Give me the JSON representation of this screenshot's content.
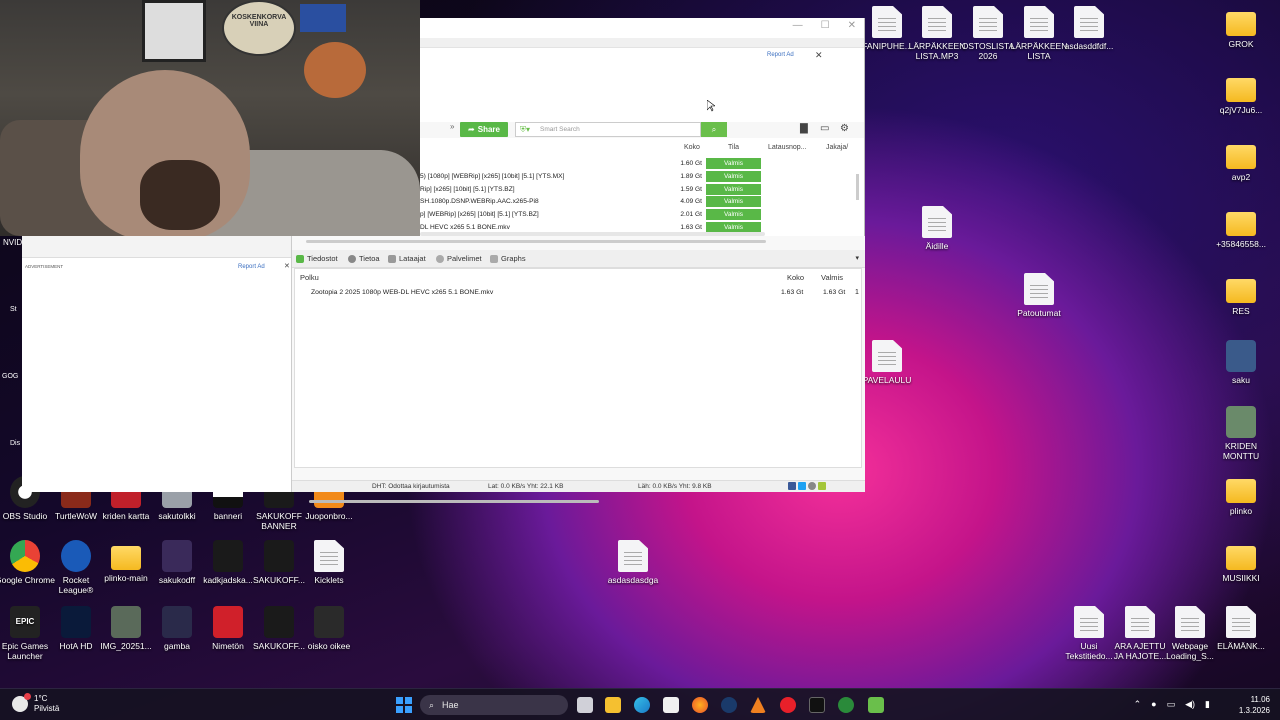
{
  "desktop": {
    "left_icons_row1": [
      "OBS Studio",
      "TurtleWoW",
      "kriden kartta",
      "sakutolkki",
      "banneri",
      "SAKUKOFF BANNER",
      "Juoponbro..."
    ],
    "left_icons_row2": [
      "Google Chrome",
      "Rocket League®",
      "plinko-main",
      "sakukodff",
      "kadkjadska...",
      "SAKUKOFF...",
      "Kicklets"
    ],
    "left_icons_row3": [
      "Epic Games Launcher",
      "HotA HD",
      "IMG_20251...",
      "gamba",
      "Nimetön",
      "SAKUKOFF...",
      "oisko oikee"
    ],
    "left_edge_labels": [
      "NVID",
      "St",
      "GOG",
      "Dis"
    ],
    "center_icon": "asdasdasdga",
    "top_row_icons": [
      "FANIPUHE...",
      "LÄRPÄKKEEN LISTA.MP3",
      "OSTOSLISTA 2026",
      "LÄRPÄKKEEN LISTA",
      "asdasddfdf..."
    ],
    "mid_icons": [
      "Äidille",
      "Patoutumat",
      "PAVELAULU"
    ],
    "right_column": [
      "GROK",
      "q2jV7Ju6...",
      "avp2",
      "+35846558...",
      "RES",
      "saku",
      "KRIDEN MONTTU",
      "plinko",
      "MUSIIKKI"
    ],
    "bottom_right_icons": [
      "Uusi Tekstitiedo...",
      "ARA AJETTU JA HAJOTE...",
      "Webpage Loading_S...",
      "ELÄMÄNK..."
    ]
  },
  "webcam": {
    "sign_text": "KOSKENKORVA VIINA"
  },
  "torrent_window": {
    "report_ad": "Report Ad",
    "ad_close": "✕",
    "toolbar": {
      "share_label": "Share",
      "search_placeholder": "Smart Search",
      "search_icon": "search-icon"
    },
    "columns": {
      "size": "Koko",
      "status": "Tila",
      "download": "Latausnop...",
      "share": "Jakaja/"
    },
    "torrents": [
      {
        "name": "",
        "size": "1.60 Gt",
        "status": "Valmis"
      },
      {
        "name": "5) [1080p] [WEBRip] [x265] [10bit] [5.1] [YTS.MX]",
        "size": "1.89 Gt",
        "status": "Valmis"
      },
      {
        "name": "Rip] [x265] [10bit] [5.1] [YTS.BZ]",
        "size": "1.59 Gt",
        "status": "Valmis"
      },
      {
        "name": "SH.1080p.DSNP.WEBRip.AAC.x265-Pi8",
        "size": "4.09 Gt",
        "status": "Valmis"
      },
      {
        "name": "p] [WEBRip] [x265] [10bit] [5.1] [YTS.BZ]",
        "size": "2.01 Gt",
        "status": "Valmis"
      },
      {
        "name": "DL HEVC x265 5.1 BONE.mkv",
        "size": "1.63 Gt",
        "status": "Valmis"
      }
    ],
    "left_ad": {
      "label": "ADVERTISEMENT",
      "report_ad": "Report Ad",
      "close": "✕"
    },
    "tabs": [
      "Tiedostot",
      "Tietoa",
      "Lataajat",
      "Palvelimet",
      "Graphs"
    ],
    "files_columns": {
      "path": "Polku",
      "size": "Koko",
      "done": "Valmis"
    },
    "files": [
      {
        "path": "Zootopia 2 2025 1080p WEB-DL HEVC x265 5.1 BONE.mkv",
        "size": "1.63 Gt",
        "done": "1.63 Gt",
        "pct": "1"
      }
    ],
    "status_bar": {
      "dht": "DHT: Odottaa kirjautumista",
      "download": "Lat: 0.0 KB/s Yht: 22.1 KB",
      "upload": "Läh: 0.0 KB/s Yht: 9.8 KB"
    }
  },
  "taskbar": {
    "temperature": "1°C",
    "weather_text": "Pilvistä",
    "search_placeholder": "Hae",
    "time": "11.06",
    "date": "1.3.2026"
  },
  "colors": {
    "accent_green": "#59b847",
    "status_green": "#6abf4b",
    "link_blue": "#3b6fc0"
  }
}
